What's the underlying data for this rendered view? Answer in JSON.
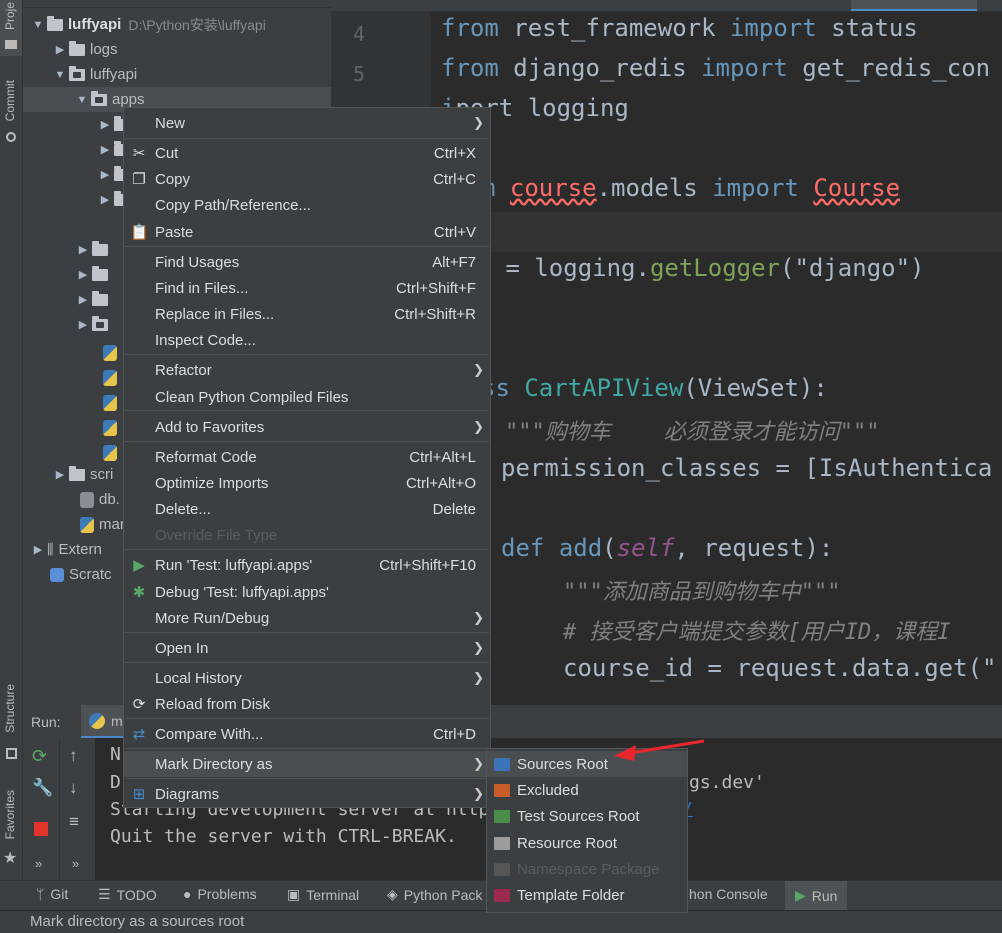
{
  "left_strip": {
    "project_label": "Proje",
    "commit_label": "Commit",
    "structure_label": "Structure",
    "favorites_label": "Favorites"
  },
  "project_tree": {
    "root": {
      "name": "luffyapi",
      "path": "D:\\Python安装\\luffyapi"
    },
    "items": [
      {
        "name": "logs"
      },
      {
        "name": "luffyapi"
      },
      {
        "name": "apps"
      },
      {
        "name": "scri"
      },
      {
        "name": "db."
      },
      {
        "name": "mar"
      },
      {
        "name": "Extern"
      },
      {
        "name": "Scratc"
      }
    ]
  },
  "editor": {
    "line_numbers": [
      "4",
      "5"
    ],
    "lines": [
      [
        "from",
        " rest_framework ",
        "import",
        " status"
      ],
      [
        "from",
        " django_redis ",
        "import",
        " get_redis_con"
      ],
      [
        "i",
        "port logging"
      ],
      [
        "m ",
        "course",
        ".models ",
        "import",
        " ",
        "Course"
      ],
      [
        " = logging.",
        "getLogger",
        "(",
        "\"django\"",
        ")"
      ],
      [
        "ss ",
        "CartAPIView",
        "(ViewSet):"
      ],
      [
        "\"\"\"购物车    必须登录才能访问\"\"\""
      ],
      [
        "permission_classes = [IsAuthentica"
      ],
      [
        "def",
        " ",
        "add",
        "(",
        "self",
        ", request):"
      ],
      [
        "\"\"\"添加商品到购物车中\"\"\""
      ],
      [
        "# 接受客户端提交参数[用户ID，课程I"
      ],
      [
        "course_id = request.data.get(\""
      ]
    ]
  },
  "run_panel": {
    "label": "Run:",
    "tab": "ma",
    "output": [
      "N",
      "D",
      "Starting development server at http",
      "Quit the server with CTRL-BREAK."
    ],
    "output_tail": "gs.dev'",
    "link_tail": "/"
  },
  "context_menu": {
    "items": [
      {
        "label": "New",
        "shortcut": "",
        "submenu": true
      },
      {
        "label": "Cut",
        "shortcut": "Ctrl+X",
        "icon": "scissors-icon"
      },
      {
        "label": "Copy",
        "shortcut": "Ctrl+C",
        "icon": "copy-icon"
      },
      {
        "label": "Copy Path/Reference...",
        "shortcut": ""
      },
      {
        "label": "Paste",
        "shortcut": "Ctrl+V",
        "icon": "clipboard-icon"
      },
      {
        "label": "Find Usages",
        "shortcut": "Alt+F7"
      },
      {
        "label": "Find in Files...",
        "shortcut": "Ctrl+Shift+F"
      },
      {
        "label": "Replace in Files...",
        "shortcut": "Ctrl+Shift+R"
      },
      {
        "label": "Inspect Code...",
        "shortcut": ""
      },
      {
        "label": "Refactor",
        "shortcut": "",
        "submenu": true
      },
      {
        "label": "Clean Python Compiled Files",
        "shortcut": ""
      },
      {
        "label": "Add to Favorites",
        "shortcut": "",
        "submenu": true
      },
      {
        "label": "Reformat Code",
        "shortcut": "Ctrl+Alt+L"
      },
      {
        "label": "Optimize Imports",
        "shortcut": "Ctrl+Alt+O"
      },
      {
        "label": "Delete...",
        "shortcut": "Delete"
      },
      {
        "label": "Override File Type",
        "shortcut": "",
        "disabled": true
      },
      {
        "label": "Run 'Test: luffyapi.apps'",
        "shortcut": "Ctrl+Shift+F10",
        "icon": "run-icon"
      },
      {
        "label": "Debug 'Test: luffyapi.apps'",
        "shortcut": "",
        "icon": "debug-icon"
      },
      {
        "label": "More Run/Debug",
        "shortcut": "",
        "submenu": true
      },
      {
        "label": "Open In",
        "shortcut": "",
        "submenu": true
      },
      {
        "label": "Local History",
        "shortcut": "",
        "submenu": true
      },
      {
        "label": "Reload from Disk",
        "shortcut": "",
        "icon": "reload-icon"
      },
      {
        "label": "Compare With...",
        "shortcut": "Ctrl+D",
        "icon": "compare-icon"
      },
      {
        "label": "Mark Directory as",
        "shortcut": "",
        "submenu": true,
        "highlighted": true
      },
      {
        "label": "Diagrams",
        "shortcut": "",
        "submenu": true,
        "icon": "diagram-icon"
      }
    ]
  },
  "submenu": {
    "items": [
      {
        "label": "Sources Root",
        "color": "#3a73b8",
        "highlighted": true
      },
      {
        "label": "Excluded",
        "color": "#c75e2a"
      },
      {
        "label": "Test Sources Root",
        "color": "#4a8c4a"
      },
      {
        "label": "Resource Root",
        "color": "#9c9c9c"
      },
      {
        "label": "Namespace Package",
        "color": "#555555",
        "disabled": true
      },
      {
        "label": "Template Folder",
        "color": "#9c2a4e"
      }
    ]
  },
  "bottom_bar": {
    "tools": [
      "Git",
      "TODO",
      "Problems",
      "Terminal",
      "Python Pack",
      "hon Console",
      "Run"
    ]
  },
  "status_bar": {
    "text": "Mark directory as a sources root"
  },
  "colors": {
    "annotation_arrow": "#e8262b"
  }
}
